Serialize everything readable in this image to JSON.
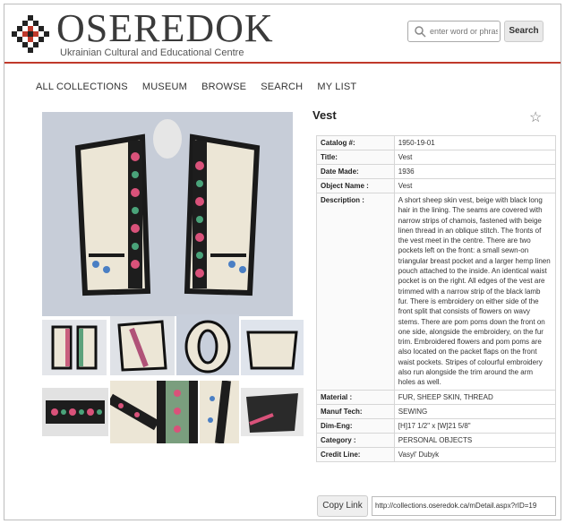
{
  "header": {
    "logo_title": "OSEREDOK",
    "logo_subtitle": "Ukrainian Cultural and Educational Centre",
    "search_placeholder": "enter word or phrase",
    "search_button": "Search",
    "accent_color": "#c0392b"
  },
  "nav": {
    "items": [
      "ALL COLLECTIONS",
      "MUSEUM",
      "BROWSE",
      "SEARCH",
      "MY LIST"
    ]
  },
  "object": {
    "title": "Vest",
    "favorite_icon": "star-icon"
  },
  "details": {
    "rows": [
      {
        "key": "Catalog #:",
        "value": "1950-19-01"
      },
      {
        "key": "Title:",
        "value": "Vest"
      },
      {
        "key": "Date Made:",
        "value": "1936"
      },
      {
        "key": "Object Name :",
        "value": "Vest"
      },
      {
        "key": "Description :",
        "value": "A short sheep skin vest, beige with black long hair in the lining. The seams are covered with narrow strips of chamois, fastened with beige linen thread in an oblique stitch. The fronts of the vest meet in the centre. There are two pockets left on the front: a small sewn-on triangular breast pocket and a larger hemp linen pouch attached to the inside. An identical waist pocket is on the right. All edges of the vest are trimmed with a narrow strip of the black lamb fur. There is embroidery on either side of the front split that consists of flowers on wavy stems. There are pom poms down the front on one side, alongside the embroidery, on the fur trim. Embroidered flowers and pom poms are also located on the packet flaps on the front waist pockets. Stripes of colourful embroidery also run alongside the trim around the arm holes as well."
      },
      {
        "key": "Material :",
        "value": "FUR, SHEEP SKIN, THREAD"
      },
      {
        "key": "Manuf Tech:",
        "value": "SEWING"
      },
      {
        "key": "Dim-Eng:",
        "value": "[H]17 1/2\" x [W]21 5/8\""
      },
      {
        "key": "Category :",
        "value": "PERSONAL OBJECTS"
      },
      {
        "key": "Credit Line:",
        "value": "Vasyl' Dubyk"
      }
    ]
  },
  "footer": {
    "copy_link_label": "Copy Link",
    "link_value": "http://collections.oseredok.ca/mDetail.aspx?rID=19"
  }
}
